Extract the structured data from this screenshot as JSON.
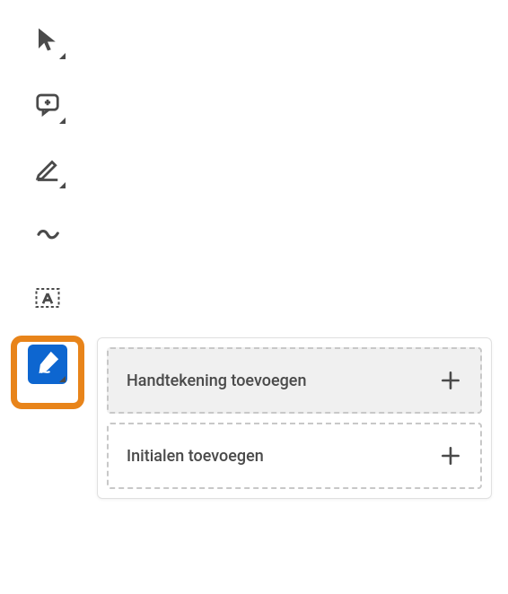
{
  "toolbar": {
    "items": [
      {
        "name": "selection-tool"
      },
      {
        "name": "comment-tool"
      },
      {
        "name": "highlight-tool"
      },
      {
        "name": "draw-tool"
      },
      {
        "name": "text-box-tool"
      },
      {
        "name": "sign-tool",
        "selected": true
      }
    ]
  },
  "popover": {
    "items": [
      {
        "label": "Handtekening toevoegen",
        "hover": true
      },
      {
        "label": "Initialen toevoegen",
        "hover": false
      }
    ]
  },
  "colors": {
    "accent": "#0d66d0",
    "highlight_ring": "#e8841a"
  }
}
